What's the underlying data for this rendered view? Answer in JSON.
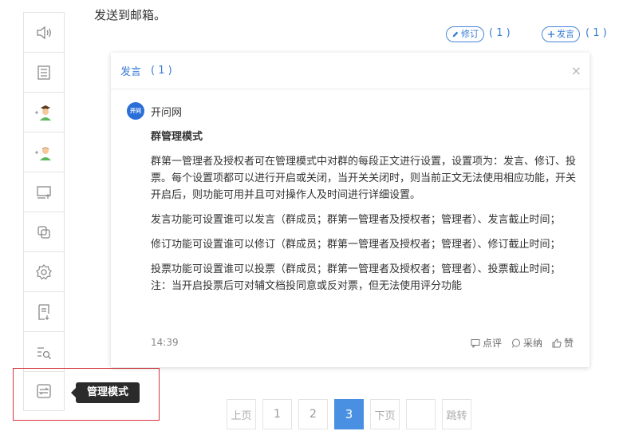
{
  "doc": {
    "top_text": "发送到邮箱。",
    "revise_label": "修订",
    "revise_count": "( 1 )",
    "speak_label": "发言",
    "speak_count": "( 1 )"
  },
  "toolbar": {
    "items": [
      {
        "icon": "speaker-icon"
      },
      {
        "icon": "list-icon"
      },
      {
        "icon": "add-admin-icon"
      },
      {
        "icon": "add-user-icon"
      },
      {
        "icon": "screen-share-icon"
      },
      {
        "icon": "copy-icon"
      },
      {
        "icon": "gear-icon"
      },
      {
        "icon": "document-download-icon"
      },
      {
        "icon": "search-list-icon"
      },
      {
        "icon": "management-mode-icon"
      }
    ],
    "tooltip": "管理模式"
  },
  "panel": {
    "header_label": "发言",
    "header_count": "( 1 )",
    "close": "×",
    "author_avatar_text": "开问",
    "author_name": "开问网",
    "title": "群管理模式",
    "paragraphs": [
      "群第一管理者及授权者可在管理模式中对群的每段正文进行设置，设置项为：发言、修订、投票。每个设置项都可以进行开启或关闭，当开关关闭时，则当前正文无法使用相应功能，开关开启后，则功能可用并且可对操作人及时间进行详细设置。",
      "发言功能可设置谁可以发言（群成员；群第一管理者及授权者；管理者）、发言截止时间；",
      "修订功能可设置谁可以修订（群成员；群第一管理者及授权者；管理者）、修订截止时间；",
      "投票功能可设置谁可以投票（群成员；群第一管理者及授权者；管理者）、投票截止时间；注：当开启投票后可对辅文档投同意或反对票，但无法使用评分功能"
    ],
    "time": "14:39",
    "actions": {
      "comment": "点评",
      "adopt": "采纳",
      "like": "赞"
    }
  },
  "pagination": {
    "prev": "上页",
    "pages": [
      "1",
      "2",
      "3"
    ],
    "current": "3",
    "next": "下页",
    "jump_input": "",
    "jump": "跳转"
  },
  "colors": {
    "accent": "#3a7bd5",
    "active_page": "#4a90e2",
    "highlight": "#d9363e"
  }
}
